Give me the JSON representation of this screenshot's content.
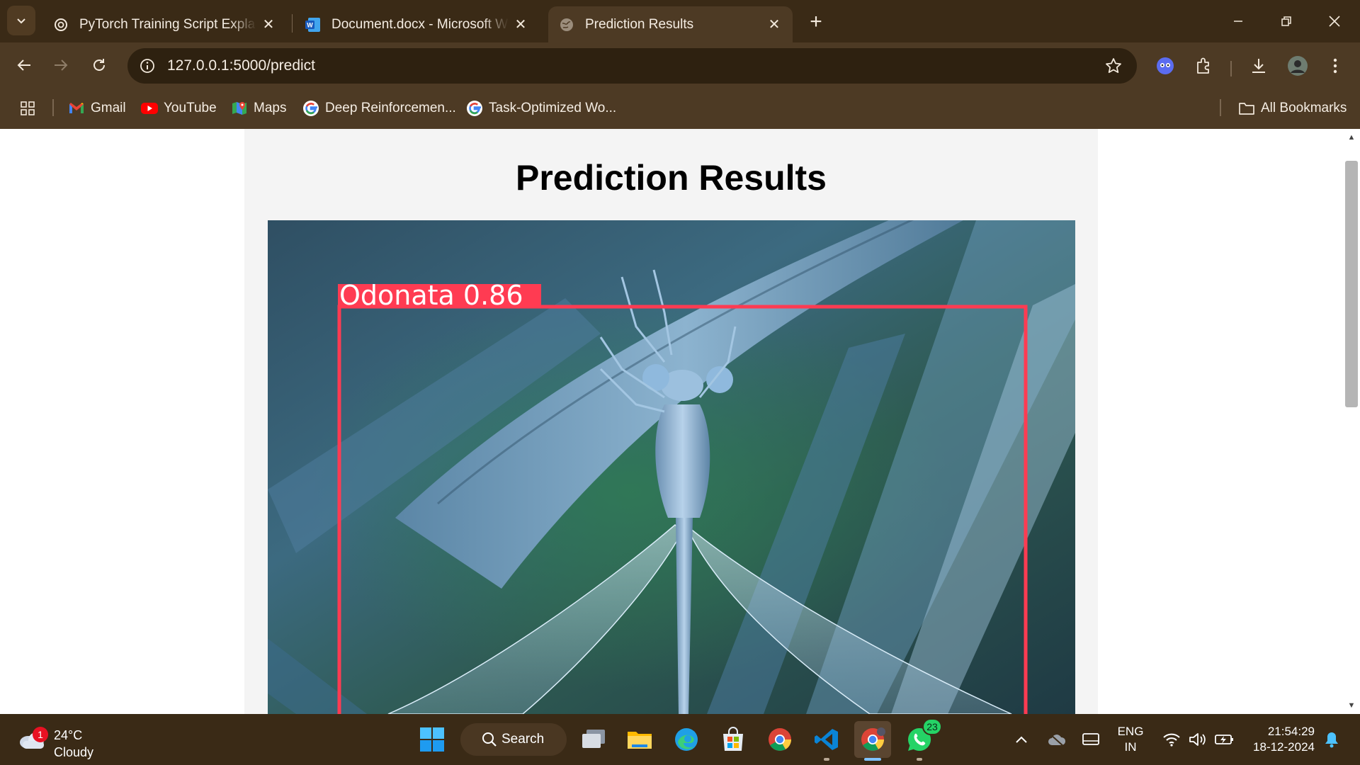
{
  "browser": {
    "tabs": [
      {
        "title": "PyTorch Training Script Explanation",
        "icon": "openai-icon",
        "active": false
      },
      {
        "title": "Document.docx - Microsoft Word",
        "icon": "word-icon",
        "active": false
      },
      {
        "title": "Prediction Results",
        "icon": "globe-icon",
        "active": true
      }
    ],
    "url": "127.0.0.1:5000/predict",
    "bookmarks": [
      {
        "label": "Gmail",
        "icon": "gmail-icon"
      },
      {
        "label": "YouTube",
        "icon": "youtube-icon"
      },
      {
        "label": "Maps",
        "icon": "maps-icon"
      },
      {
        "label": "Deep Reinforcemen...",
        "icon": "google-icon"
      },
      {
        "label": "Task-Optimized Wo...",
        "icon": "google-icon"
      }
    ],
    "all_bookmarks_label": "All Bookmarks"
  },
  "page": {
    "title": "Prediction Results",
    "detection": {
      "label": "Odonata 0.86",
      "class": "Odonata",
      "confidence": 0.86,
      "box_color": "#ff3b52"
    }
  },
  "taskbar": {
    "weather": {
      "temp": "24°C",
      "condition": "Cloudy",
      "badge": "1"
    },
    "search_label": "Search",
    "whatsapp_badge": "23",
    "language": {
      "line1": "ENG",
      "line2": "IN"
    },
    "clock": {
      "time": "21:54:29",
      "date": "18-12-2024"
    }
  },
  "colors": {
    "chrome_dark": "#3a2a16",
    "chrome_mid": "#4d3a24",
    "accent": "#ff3b52"
  }
}
